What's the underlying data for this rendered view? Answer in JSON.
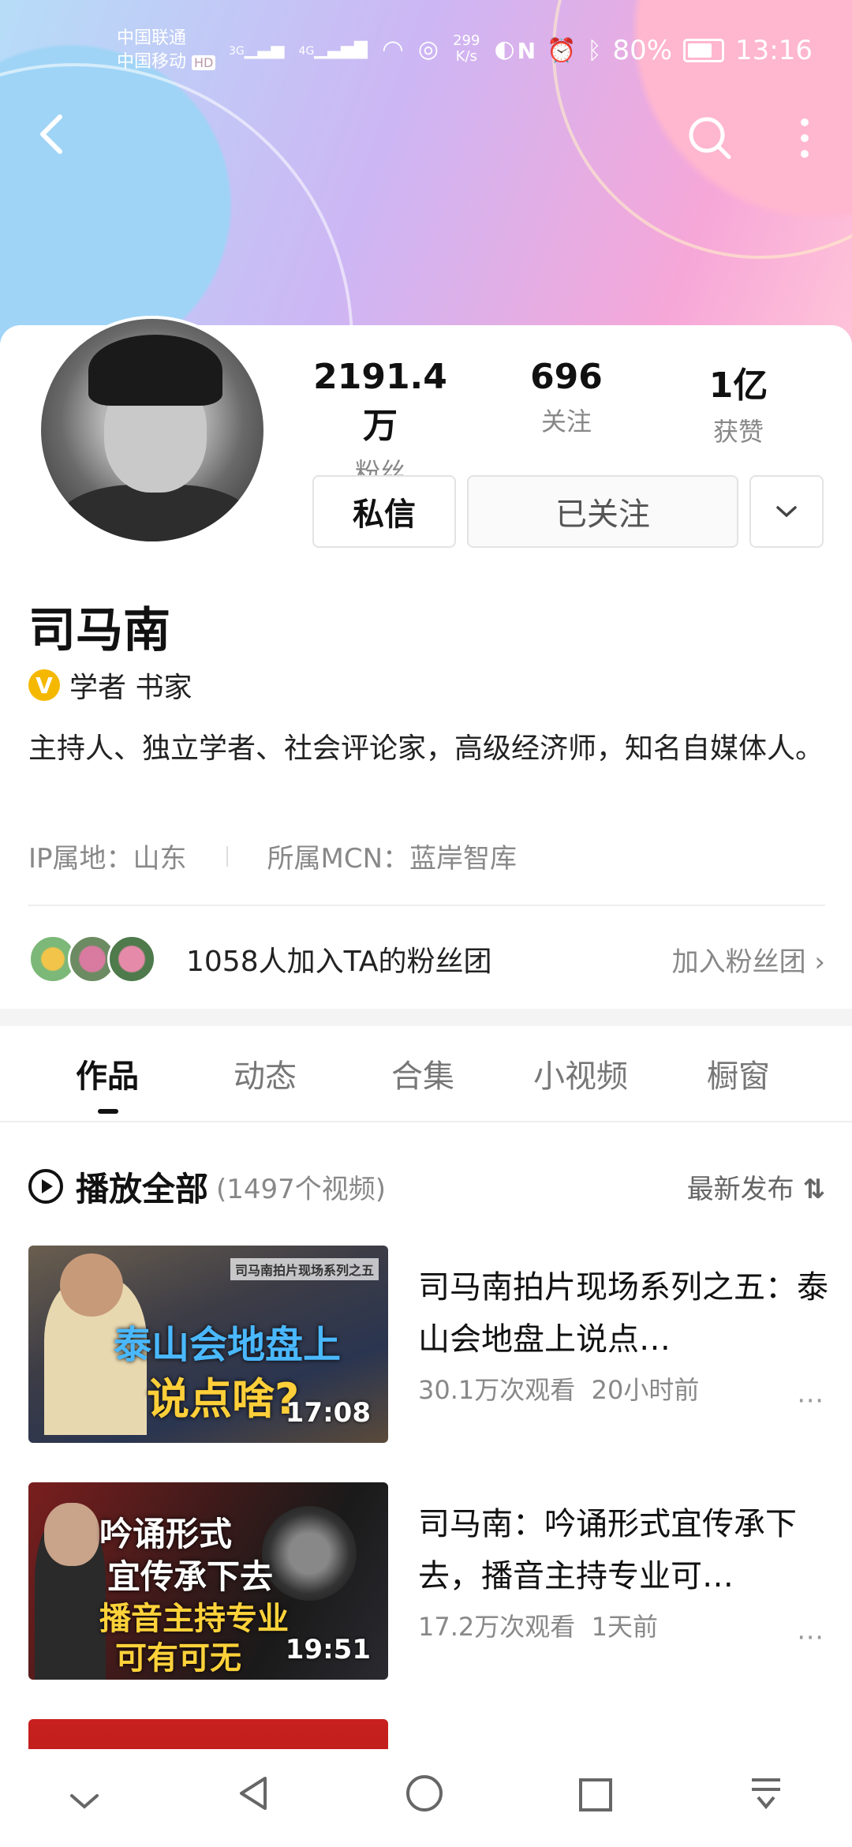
{
  "status_bar": {
    "carrier1": "中国联通",
    "carrier2": "中国移动",
    "hd": "HD",
    "net1": "3G",
    "net2": "4G",
    "speed_value": "299",
    "speed_unit": "K/s",
    "battery": "80%",
    "time": "13:16"
  },
  "profile": {
    "name": "司马南",
    "verified_tag": "学者 书家",
    "bio": "主持人、独立学者、社会评论家，高级经济师，知名自媒体人。",
    "ip_location": "IP属地：山东",
    "mcn": "所属MCN：蓝岸智库",
    "stats": [
      {
        "value": "2191.4万",
        "label": "粉丝"
      },
      {
        "value": "696",
        "label": "关注"
      },
      {
        "value": "1亿",
        "label": "获赞"
      }
    ],
    "buttons": {
      "message": "私信",
      "followed": "已关注"
    },
    "fan_club": {
      "text": "1058人加入TA的粉丝团",
      "join": "加入粉丝团"
    }
  },
  "tabs": [
    "作品",
    "动态",
    "合集",
    "小视频",
    "橱窗"
  ],
  "play_all": {
    "label": "播放全部",
    "count": "(1497个视频)",
    "sort": "最新发布"
  },
  "videos": [
    {
      "title": "司马南拍片现场系列之五：泰山会地盘上说点…",
      "views": "30.1万次观看",
      "time": "20小时前",
      "duration": "17:08",
      "thumb_text_top": "司马南拍片现场系列之五",
      "thumb_text_1": "泰山会地盘上",
      "thumb_text_2": "说点啥?"
    },
    {
      "title": "司马南：吟诵形式宜传承下去，播音主持专业可…",
      "views": "17.2万次观看",
      "time": "1天前",
      "duration": "19:51",
      "thumb_text_1": "吟诵形式",
      "thumb_text_2": "宜传承下去",
      "thumb_text_3": "播音主持专业",
      "thumb_text_4": "可有可无"
    }
  ]
}
